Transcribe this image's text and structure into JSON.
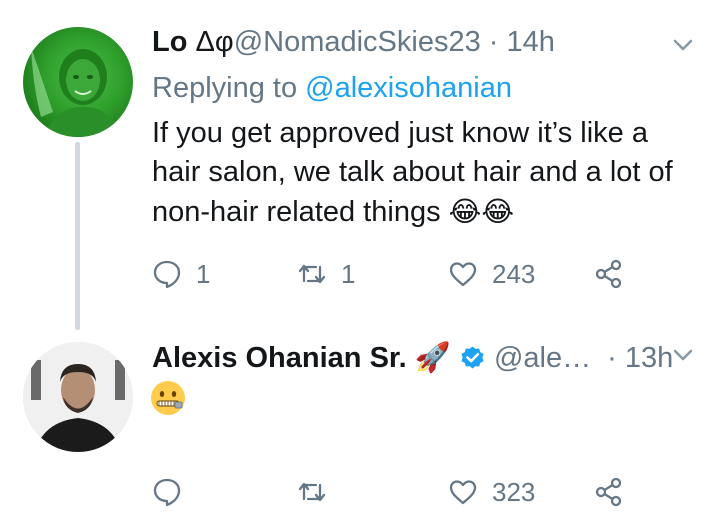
{
  "tweets": [
    {
      "display_name": "Lo",
      "name_suffix": "Δφ",
      "handle": "@NomadicSkies23",
      "time": "14h",
      "replying_prefix": "Replying to ",
      "replying_handle": "@alexisohanian",
      "text": "If you get approved just know it’s like a hair salon, we talk about hair and a lot of non-hair related things",
      "emojis": "😂😂",
      "reply_count": "1",
      "retweet_count": "1",
      "like_count": "243"
    },
    {
      "display_name": "Alexis Ohanian Sr.",
      "name_emoji": "🚀",
      "handle": "@ale…",
      "time": "13h",
      "reply_count": "",
      "retweet_count": "",
      "like_count": "323",
      "verified": true
    }
  ],
  "icons": [
    "chevron-down-icon",
    "reply-icon",
    "retweet-icon",
    "like-icon",
    "share-icon",
    "verified-badge-icon"
  ],
  "colors": {
    "text_primary": "#14171a",
    "text_secondary": "#657786",
    "link": "#1da1f2",
    "verified": "#1da1f2",
    "thread_line": "#cfd9de"
  }
}
